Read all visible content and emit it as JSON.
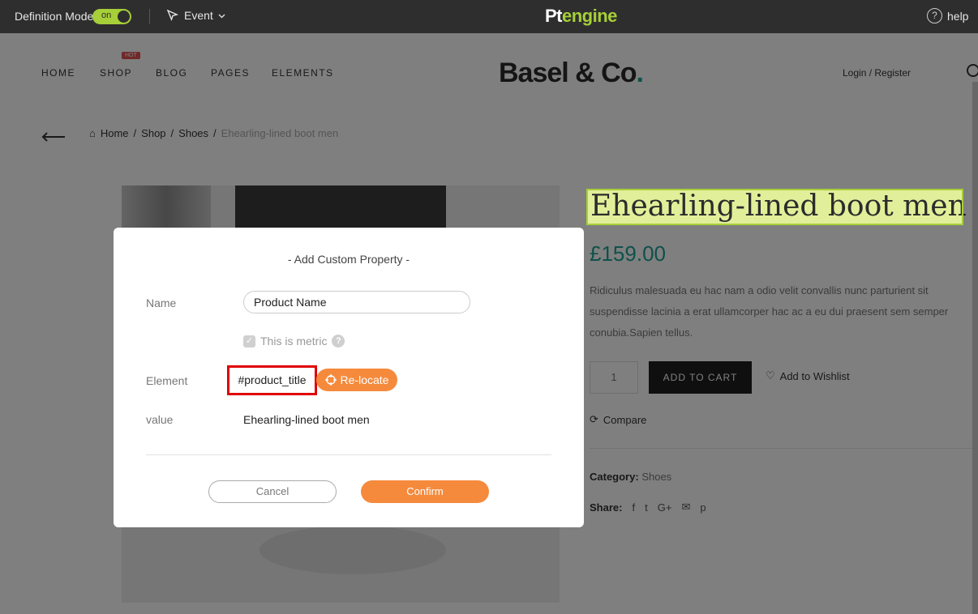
{
  "topbar": {
    "definition_mode_label": "Definition Mode",
    "toggle_state": "on",
    "event_label": "Event",
    "brand_pt": "Pt",
    "brand_engine": "engine",
    "help_label": "help"
  },
  "site": {
    "nav": [
      "HOME",
      "SHOP",
      "BLOG",
      "PAGES",
      "ELEMENTS"
    ],
    "hot_badge": "HOT",
    "logo_text": "Basel & Co",
    "logo_dot": ".",
    "login": "Login / Register",
    "breadcrumbs": [
      "Home",
      "Shop",
      "Shoes"
    ],
    "breadcrumb_current": "Ehearling-lined boot men",
    "product_title": "Ehearling-lined boot men",
    "price": "£159.00",
    "description": "Ridiculus malesuada eu hac nam a odio velit convallis nunc parturient sit suspendisse lacinia a erat ullamcorper hac ac a eu dui praesent sem semper conubia.Sapien tellus.",
    "qty": "1",
    "add_to_cart": "ADD TO CART",
    "wishlist": "Add to Wishlist",
    "compare": "Compare",
    "category_label": "Category:",
    "category_value": "Shoes",
    "share_label": "Share:",
    "share_icons": [
      "f",
      "t",
      "G+",
      "✉",
      "p"
    ]
  },
  "modal": {
    "title": "- Add Custom Property -",
    "name_label": "Name",
    "name_value": "Product Name",
    "metric_label": "This is metric",
    "metric_checked": true,
    "element_label": "Element",
    "element_selector": "#product_title",
    "relocate_label": "Re-locate",
    "value_label": "value",
    "value_text": "Ehearling-lined boot men",
    "cancel_label": "Cancel",
    "confirm_label": "Confirm"
  },
  "colors": {
    "accent_green": "#a6cf38",
    "accent_orange": "#f58a3c",
    "highlight_red": "#e00000"
  }
}
